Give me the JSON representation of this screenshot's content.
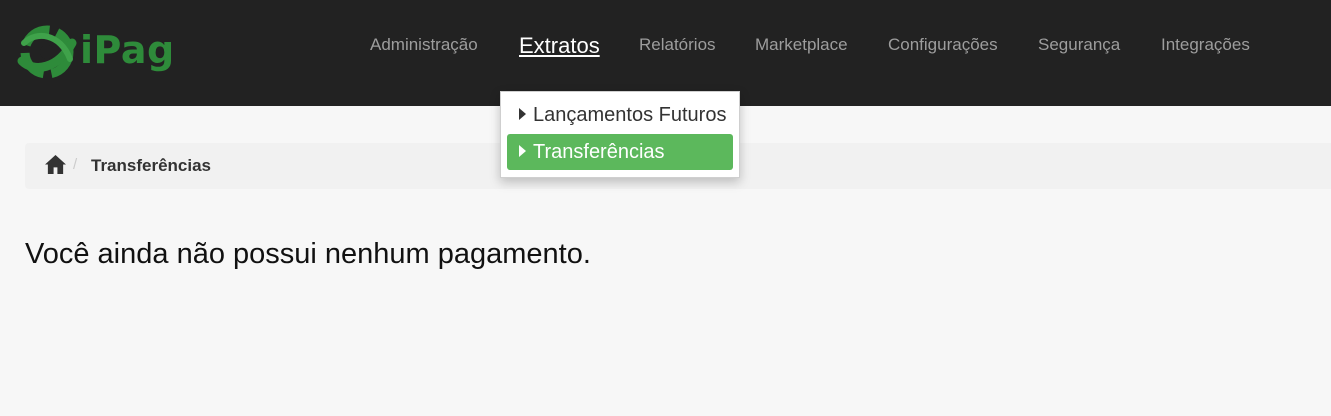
{
  "brand": {
    "name": "iPag"
  },
  "nav": {
    "items": [
      {
        "label": "Administração"
      },
      {
        "label": "Extratos"
      },
      {
        "label": "Relatórios"
      },
      {
        "label": "Marketplace"
      },
      {
        "label": "Configurações"
      },
      {
        "label": "Segurança"
      },
      {
        "label": "Integrações"
      }
    ],
    "active": "Extratos"
  },
  "dropdown": {
    "items": [
      {
        "label": "Lançamentos Futuros"
      },
      {
        "label": "Transferências"
      }
    ],
    "selected": "Transferências"
  },
  "breadcrumb": {
    "separator": "/",
    "current": "Transferências"
  },
  "main": {
    "empty_message": "Você ainda não possui nenhum pagamento."
  },
  "colors": {
    "topbar": "#222222",
    "nav_text": "#9d9d9d",
    "brand_green": "#2e8b3a",
    "selected_green": "#5cb85c",
    "page_bg": "#f7f7f7"
  }
}
